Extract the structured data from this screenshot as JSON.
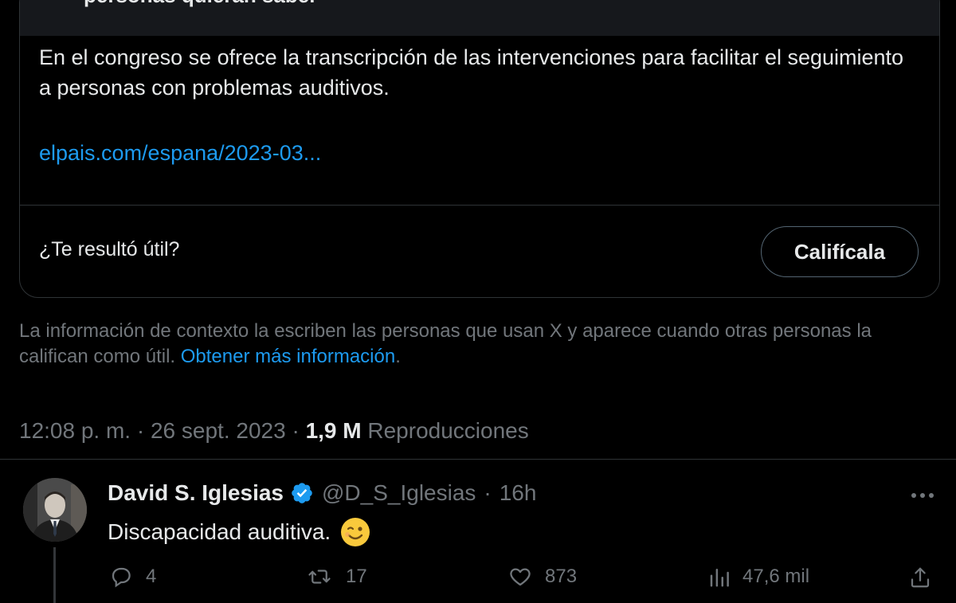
{
  "note": {
    "title": "personas quieran saber",
    "body": "En el congreso se ofrece la transcripción de las intervenciones para facilitar el seguimiento a personas con problemas auditivos.",
    "link": "elpais.com/espana/2023-03...",
    "helpful_question": "¿Te resultó útil?",
    "rate_button": "Califícala"
  },
  "context": {
    "text": "La información de contexto la escriben las personas que usan X y aparece cuando otras personas la califican como útil.",
    "link": "Obtener más información",
    "period": "."
  },
  "tweet_meta": {
    "time": "12:08 p. m.",
    "sep1": " · ",
    "date": "26 sept. 2023",
    "sep2": " · ",
    "views": "1,9 M",
    "views_label": "Reproducciones"
  },
  "reply": {
    "author": "David S. Iglesias",
    "handle": "@D_S_Iglesias",
    "dot": "·",
    "time": "16h",
    "text": "Discapacidad auditiva.",
    "actions": {
      "replies": "4",
      "retweets": "17",
      "likes": "873",
      "views": "47,6 mil"
    }
  },
  "icons": {
    "verified": "verified-badge-icon",
    "more": "more-icon",
    "reply": "reply-icon",
    "retweet": "retweet-icon",
    "like": "heart-icon",
    "views": "views-chart-icon",
    "share": "share-icon",
    "emoji": "winking-face-emoji"
  },
  "colors": {
    "background": "#000000",
    "text": "#e7e9ea",
    "muted": "#71767b",
    "link": "#1d9bf0",
    "border": "#2f3336"
  }
}
